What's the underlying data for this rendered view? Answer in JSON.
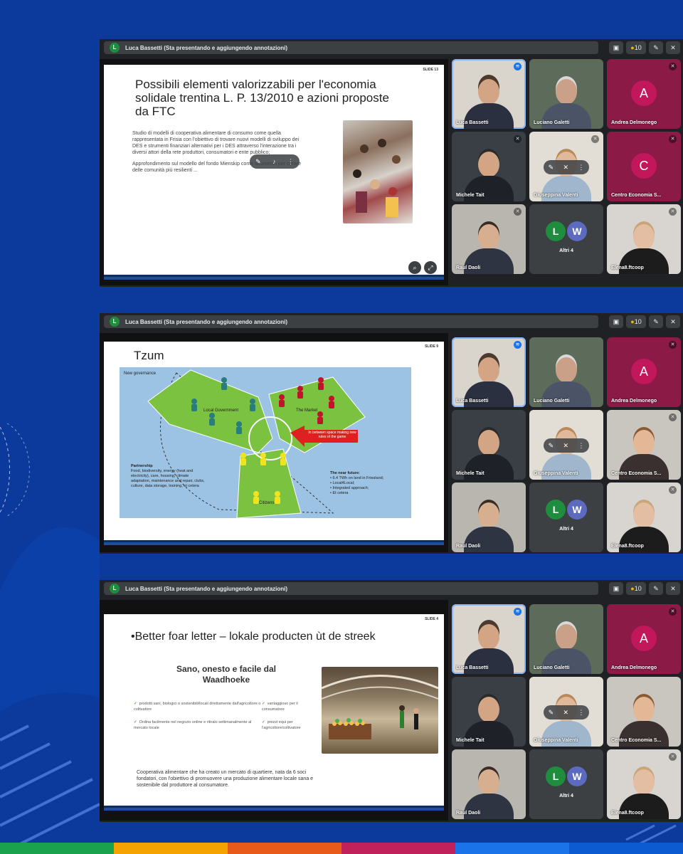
{
  "background": {
    "color": "#0b3a9c",
    "band_colors": [
      "#1ba24d",
      "#f4a300",
      "#e85a1a",
      "#c0215a",
      "#1a73e8",
      "#0d5bd1"
    ]
  },
  "panels": [
    {
      "presenter": {
        "initial": "L",
        "text": "Luca Bassetti (Sta presentando e aggiungendo annotazioni)"
      },
      "toolbar": {
        "count": "10"
      },
      "slide": {
        "number": "SLIDE 13",
        "title": "Possibili elementi valorizzabili per l'economia solidale trentina L. P. 13/2010 e azioni proposte da FTC",
        "para1": "Studio di modelli di cooperativa alimentare di consumo come quella rappresentata in Frisia con l'obiettivo di trovare nuovi modelli di sviluppo dei DES e strumenti finanziari alternativi per i DES attraverso l'interazione tra i diversi attori della rete produttori, consumatori e ente pubblico;",
        "para2": "Approfondimento sul modello del fondo Mienskip come strumento per creare delle comunità più resilienti ..."
      },
      "tiles": [
        {
          "name": "Luca Bassetti",
          "type": "video",
          "speaking": true
        },
        {
          "name": "Luciano Galetti",
          "type": "video"
        },
        {
          "name": "Andrea Delmonego",
          "type": "avatar",
          "initial": "A",
          "color": "#c2185b",
          "bg": "#8b1a47"
        },
        {
          "name": "Michele Tait",
          "type": "video"
        },
        {
          "name": "Giuseppina Valenti",
          "type": "video",
          "controls": true
        },
        {
          "name": "Centro Economia S...",
          "type": "avatar",
          "initial": "C",
          "color": "#c2185b",
          "bg": "#8b1a47"
        },
        {
          "name": "Raul Daoli",
          "type": "video"
        },
        {
          "name": "Altri 4",
          "type": "others"
        },
        {
          "name": "Elena8.ftcoop",
          "type": "video"
        }
      ]
    },
    {
      "presenter": {
        "initial": "L",
        "text": "Luca Bassetti (Sta presentando e aggiungendo annotazioni)"
      },
      "toolbar": {
        "count": "10"
      },
      "slide": {
        "number": "SLIDE 9",
        "title": "Tzum",
        "new_governance": "New governance",
        "local_government": "Local Government",
        "the_market": "The Market",
        "citizens": "Citizens",
        "arrow_text": "In between space making new rules of the game",
        "partnership_title": "Partnership",
        "partnership_text": "Food, biodiversity, energy (heat and electricity), care, housing, climate adaptation, maintenance and repair, clubs, culture, data storage, training, et cetera",
        "near_future_title": "The near future:",
        "near_future_items": [
          "6.4 TWh on land in Friesland;",
          "Local4Local;",
          "Integrated approach;",
          "Et cetera"
        ]
      },
      "tiles": [
        {
          "name": "Luca Bassetti",
          "type": "video",
          "speaking": true
        },
        {
          "name": "Luciano Galetti",
          "type": "video"
        },
        {
          "name": "Andrea Delmonego",
          "type": "avatar",
          "initial": "A",
          "color": "#c2185b",
          "bg": "#8b1a47"
        },
        {
          "name": "Michele Tait",
          "type": "video"
        },
        {
          "name": "Giuseppina Valenti",
          "type": "video",
          "controls": true
        },
        {
          "name": "Centro Economia S...",
          "type": "video"
        },
        {
          "name": "Raul Daoli",
          "type": "video"
        },
        {
          "name": "Altri 4",
          "type": "others"
        },
        {
          "name": "Elena8.ftcoop",
          "type": "video"
        }
      ]
    },
    {
      "presenter": {
        "initial": "L",
        "text": "Luca Bassetti (Sta presentando e aggiungendo annotazioni)"
      },
      "toolbar": {
        "count": "10"
      },
      "slide": {
        "number": "SLIDE 4",
        "title": "•Better foar letter – lokale producten ùt de streek",
        "subtitle": "Sano, onesto e facile dal Waadhoeke",
        "bullets_left": [
          "prodotti sani, biologici o sostenibili/locali direttamente dall'agricoltore o coltivatore",
          "Ordina facilmente nel negozio online e ritiralo settimanalmente al mercato locale"
        ],
        "bullets_right": [
          "vantaggioso per il consumatore",
          "prezzi equi per l'agricoltore/coltivatore"
        ],
        "body": "Cooperativa alimentare che ha creato un mercato di quartiere, nata da 6 soci fondatori, con l'obiettivo di promuovere una produzione alimentare locale sana e sostenibile dal produttore al consumatore."
      },
      "tiles": [
        {
          "name": "Luca Bassetti",
          "type": "video",
          "speaking": true
        },
        {
          "name": "Luciano Galetti",
          "type": "video"
        },
        {
          "name": "Andrea Delmonego",
          "type": "avatar",
          "initial": "A",
          "color": "#c2185b",
          "bg": "#8b1a47"
        },
        {
          "name": "Michele Tait",
          "type": "video"
        },
        {
          "name": "Giuseppina Valenti",
          "type": "video",
          "controls": true
        },
        {
          "name": "Centro Economia S...",
          "type": "video"
        },
        {
          "name": "Raul Daoli",
          "type": "video"
        },
        {
          "name": "Altri 4",
          "type": "others"
        },
        {
          "name": "Elena8.ftcoop",
          "type": "video"
        }
      ]
    }
  ]
}
